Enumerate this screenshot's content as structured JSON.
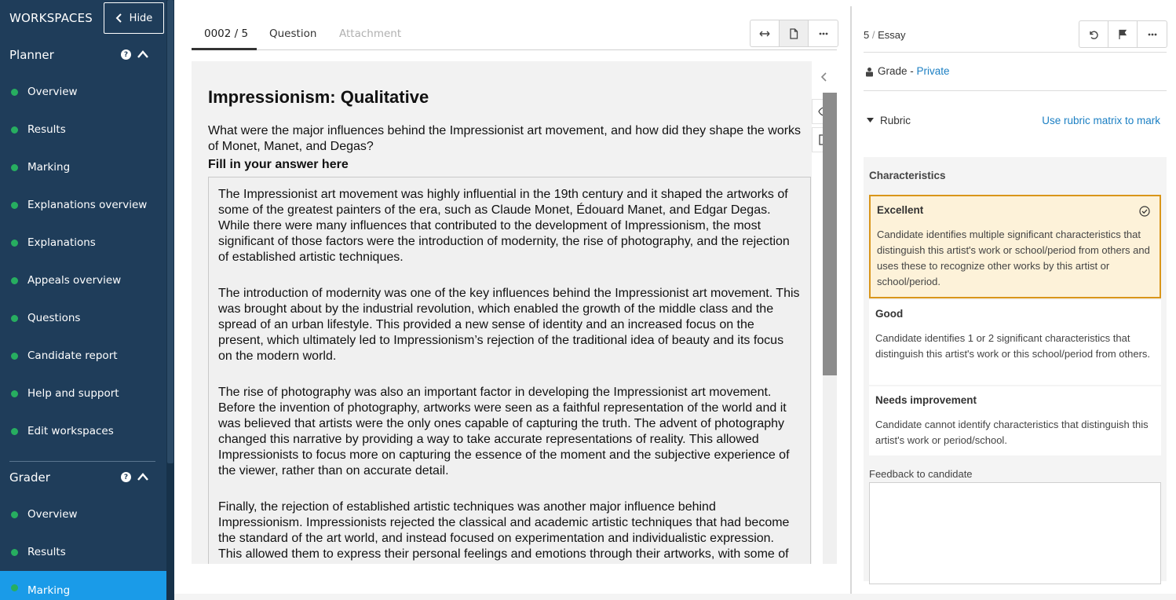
{
  "sidebar": {
    "title": "WORKSPACES",
    "hide_label": "Hide",
    "planner": {
      "label": "Planner",
      "items": [
        {
          "label": "Overview"
        },
        {
          "label": "Results"
        },
        {
          "label": "Marking"
        },
        {
          "label": "Explanations overview"
        },
        {
          "label": "Explanations"
        },
        {
          "label": "Appeals overview"
        },
        {
          "label": "Questions"
        },
        {
          "label": "Candidate report"
        },
        {
          "label": "Help and support"
        },
        {
          "label": "Edit workspaces"
        }
      ]
    },
    "grader": {
      "label": "Grader",
      "items": [
        {
          "label": "Overview"
        },
        {
          "label": "Results"
        },
        {
          "label": "Marking",
          "active": true
        }
      ]
    },
    "colors": {
      "background": "#1f3d5a",
      "active": "#1a9be8",
      "status_dot": "#27ae60"
    }
  },
  "question_tabs": {
    "counter": "0002 / 5",
    "question": "Question",
    "attachment": "Attachment"
  },
  "question": {
    "title": "Impressionism: Qualitative",
    "text": "What were the major influences behind the Impressionist art movement, and how did they shape the works of Monet, Manet, and Degas?",
    "fill_label": "Fill in your answer here",
    "answer_paragraphs": [
      "The Impressionist art movement was highly influential in the 19th century and it shaped the artworks of some of the greatest painters of the era, such as Claude Monet, Édouard Manet, and Edgar Degas. While there were many influences that contributed to the development of Impressionism, the most significant of those factors were the introduction of modernity, the rise of photography, and the rejection of established artistic techniques.",
      "The introduction of modernity was one of the key influences behind the Impressionist art movement. This was brought about by the industrial revolution, which enabled the growth of the middle class and the spread of an urban lifestyle. This provided a new sense of identity and an increased focus on the present, which ultimately led to Impressionism’s rejection of the traditional idea of beauty and its focus on the modern world.",
      "The rise of photography was also an important factor in developing the Impressionist art movement. Before the invention of photography, artworks were seen as a faithful representation of the world and it was believed that artists were the only ones capable of capturing the truth. The advent of photography changed this narrative by providing a way to take accurate representations of reality. This allowed Impressionists to focus more on capturing the essence of the moment and the subjective experience of the viewer, rather than on accurate detail.",
      "Finally, the rejection of established artistic techniques was another major influence behind Impressionism. Impressionists rejected the classical and academic artistic techniques that had become the standard of the art world, and instead focused on experimentation and individualistic expression. This allowed them to express their personal feelings and emotions through their artworks, with some of"
    ]
  },
  "grading": {
    "question_number": "5",
    "separator": "/",
    "question_type": "Essay",
    "grade_label": "Grade -",
    "grade_visibility": "Private",
    "rubric_label": "Rubric",
    "rubric_matrix_link": "Use rubric matrix to mark",
    "characteristics_title": "Characteristics",
    "criteria": [
      {
        "name": "Excellent",
        "description": "Candidate identifies multiple significant characteristics that distinguish this artist's work or school/period from others and uses these to recognize other works by this artist or school/period.",
        "selected": true
      },
      {
        "name": "Good",
        "description": "Candidate identifies 1 or 2 significant characteristics that distinguish this artist's work or this school/period from others.",
        "selected": false
      },
      {
        "name": "Needs improvement",
        "description": "Candidate cannot identify characteristics that distinguish this artist's work or period/school.",
        "selected": false
      }
    ],
    "feedback_label": "Feedback to candidate",
    "feedback_value": "",
    "colors": {
      "link": "#1b7fc3",
      "selected_fill": "#fdf2d9",
      "selected_border": "#d9961a"
    }
  }
}
